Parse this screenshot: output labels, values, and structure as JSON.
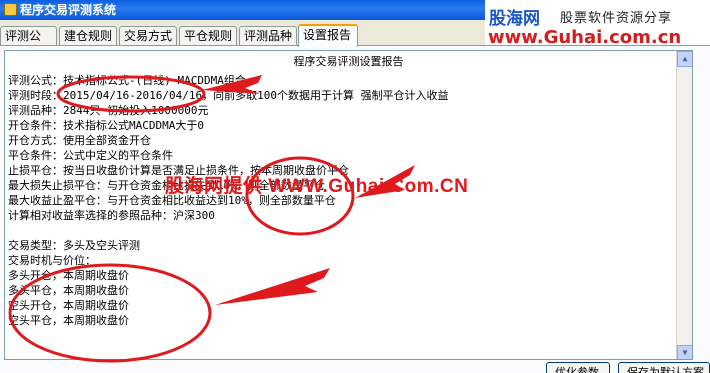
{
  "window": {
    "title": "程序交易评测系统"
  },
  "brand": {
    "logo": "股海网",
    "slogan": "股票软件资源分享",
    "url": "www.Guhai.com.cn"
  },
  "tabs": [
    {
      "label": "评测公式",
      "active": false
    },
    {
      "label": "建仓规则",
      "active": false
    },
    {
      "label": "交易方式",
      "active": false
    },
    {
      "label": "平仓规则",
      "active": false
    },
    {
      "label": "评测品种",
      "active": false
    },
    {
      "label": "设置报告",
      "active": true
    }
  ],
  "report": {
    "title": "程序交易评测设置报告",
    "lines": [
      "评测公式：技术指标公式-(日线)-MACDDMA组合",
      "评测时段：2015/04/16-2016/04/16，向前多取100个数据用于计算 强制平仓计入收益",
      "评测品种：2844只 初始投入1000000元",
      "开仓条件：技术指标公式MACDDMA大于0",
      "开仓方式：使用全部资金开仓",
      "平仓条件：公式中定义的平仓条件",
      "止损平仓：按当日收盘价计算是否满足止损条件，按本周期收盘价平仓",
      "          最大损失止损平仓：与开仓资金相比损失到10%，则全部数量平仓",
      "          最大收益止盈平仓：与开仓资金相比收益达到10%，则全部数量平仓",
      "          计算相对收益率选择的参照品种：沪深300",
      "",
      "交易类型：多头及空头评测",
      "交易时机与价位：",
      "          多头开仓，本周期收盘价",
      "          多头平仓，本周期收盘价",
      "          空头开仓，本周期收盘价",
      "          空头平仓，本周期收盘价"
    ]
  },
  "watermark": "股海网提供 WWW.Guhai.Com.CN",
  "buttons": {
    "save_params": "优化参数",
    "save_plan": "保存为默认方案"
  },
  "colors": {
    "titlebar": "#0a5fe0",
    "annotation_red": "#e0191c",
    "brand_blue": "#1a57c9"
  }
}
